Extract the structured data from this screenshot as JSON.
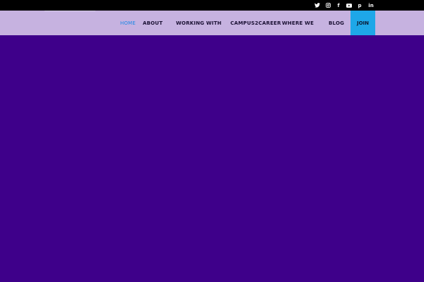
{
  "top_bar": {
    "social_icons": [
      {
        "name": "twitter",
        "glyph": ""
      },
      {
        "name": "instagram",
        "glyph": ""
      },
      {
        "name": "facebook",
        "glyph": "f"
      },
      {
        "name": "youtube",
        "glyph": ""
      },
      {
        "name": "pinterest",
        "glyph": "p"
      },
      {
        "name": "linkedin",
        "glyph": "in"
      }
    ]
  },
  "nav": {
    "items": [
      {
        "label": "HOME",
        "active": true
      },
      {
        "label": "ABOUT"
      },
      {
        "label": "WORKING WITH"
      },
      {
        "label": "CAMPUS2CAREER"
      },
      {
        "label": "WHERE WE"
      },
      {
        "label": "BLOG"
      },
      {
        "label": "JOIN"
      }
    ]
  },
  "colors": {
    "top_bar": "#000000",
    "nav_background": "#c6b2e0",
    "active_link": "#1e88e5",
    "join_background": "#1ea7e8",
    "hero_background": "#3e008a"
  }
}
